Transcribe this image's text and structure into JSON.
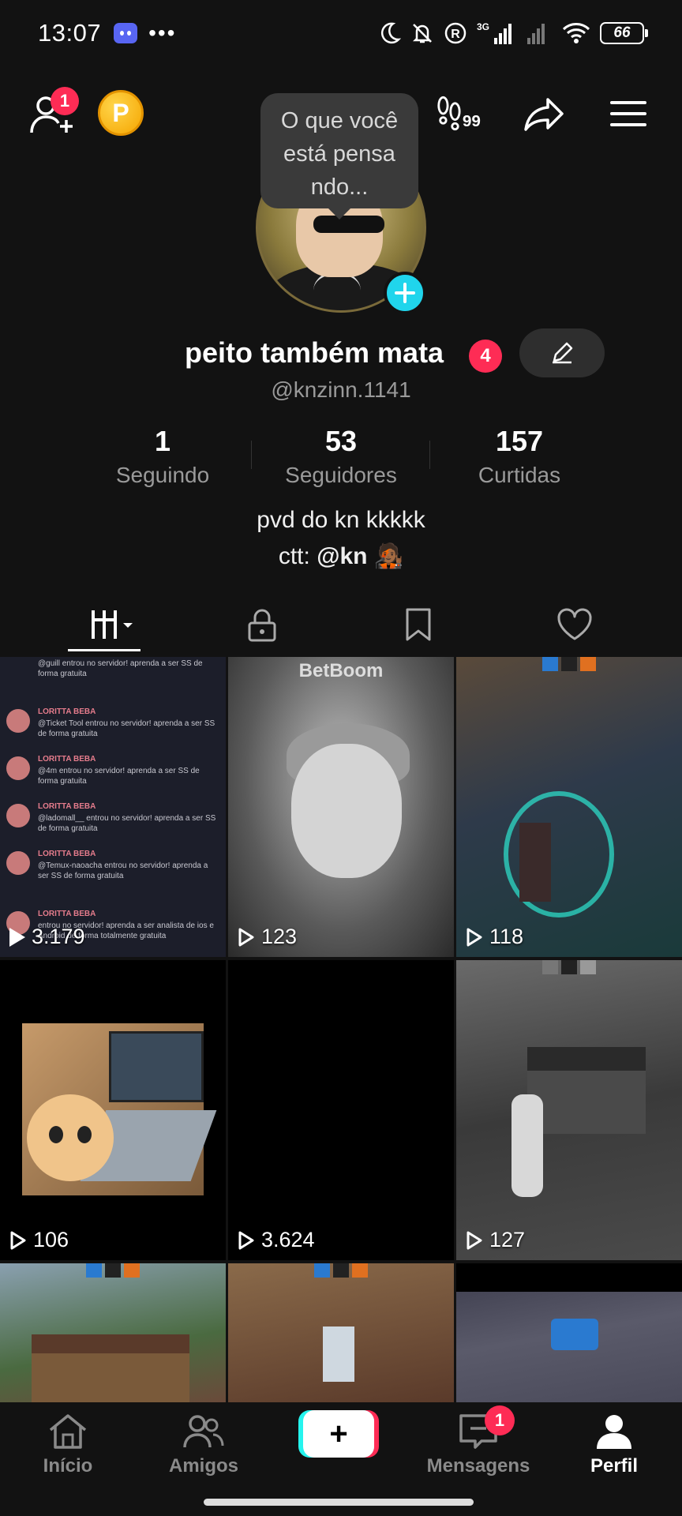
{
  "status_bar": {
    "time": "13:07",
    "dots": "•••",
    "network": "3G",
    "battery": "66",
    "icons": [
      "discord-icon",
      "moon-icon",
      "bell-off-icon",
      "registered-icon",
      "signal-icon",
      "wifi-icon",
      "battery-icon"
    ]
  },
  "top_bar": {
    "add_friend_badge": "1",
    "coin_label": "P",
    "icons": [
      "add-friend-icon",
      "coin-icon",
      "footprints-icon",
      "share-icon",
      "menu-icon"
    ],
    "footprints_count": "99"
  },
  "profile": {
    "thought_bubble": "O que você está pensa ndo...",
    "display_name": "peito também mata",
    "name_badge": "4",
    "handle": "@knzinn.1141",
    "stats": [
      {
        "value": "1",
        "label": "Seguindo"
      },
      {
        "value": "53",
        "label": "Seguidores"
      },
      {
        "value": "157",
        "label": "Curtidas"
      }
    ],
    "bio_line1": "pvd do kn kkkkk",
    "bio_line2_prefix": "ctt: ",
    "bio_line2_bold": "@kn",
    "bio_emoji": "🧑🏾‍🎤"
  },
  "tabs": [
    "videos-grid-tab",
    "private-tab",
    "saved-tab",
    "liked-tab"
  ],
  "videos": [
    {
      "views": "3.179",
      "thumb": "chat"
    },
    {
      "views": "123",
      "thumb": "meme"
    },
    {
      "views": "118",
      "thumb": "game"
    },
    {
      "views": "106",
      "thumb": "cat"
    },
    {
      "views": "3.624",
      "thumb": "black"
    },
    {
      "views": "127",
      "thumb": "game-bw"
    },
    {
      "views": "",
      "thumb": "game"
    },
    {
      "views": "",
      "thumb": "game"
    },
    {
      "views": "",
      "thumb": "game"
    }
  ],
  "chat_thumb": {
    "lines": [
      {
        "name": "LORITTA BEBA",
        "text": "@guill entrou no servidor! aprenda a ser SS de forma gratuita"
      },
      {
        "name": "LORITTA BEBA",
        "text": "@Ticket Tool entrou no servidor! aprenda a ser SS de forma gratuita"
      },
      {
        "name": "LORITTA BEBA",
        "text": "@4m entrou no servidor! aprenda a ser SS de forma gratuita"
      },
      {
        "name": "LORITTA BEBA",
        "text": "@ladomall__ entrou no servidor! aprenda a ser SS de forma gratuita"
      },
      {
        "name": "LORITTA BEBA",
        "text": "@Temux-naoacha entrou no servidor! aprenda a ser SS de forma gratuita"
      },
      {
        "name": "LORITTA BEBA",
        "text": "entrou no servidor! aprenda a ser analista de ios e Android de forma totalmente gratuita"
      }
    ]
  },
  "meme_thumb": {
    "text": "BetBoom"
  },
  "bottom_nav": {
    "items": [
      {
        "label": "Início",
        "icon": "home-icon"
      },
      {
        "label": "Amigos",
        "icon": "friends-icon"
      },
      {
        "label": "",
        "icon": "plus-icon"
      },
      {
        "label": "Mensagens",
        "icon": "inbox-icon"
      },
      {
        "label": "Perfil",
        "icon": "profile-icon"
      }
    ],
    "messages_badge": "1",
    "plus_label": "+"
  }
}
